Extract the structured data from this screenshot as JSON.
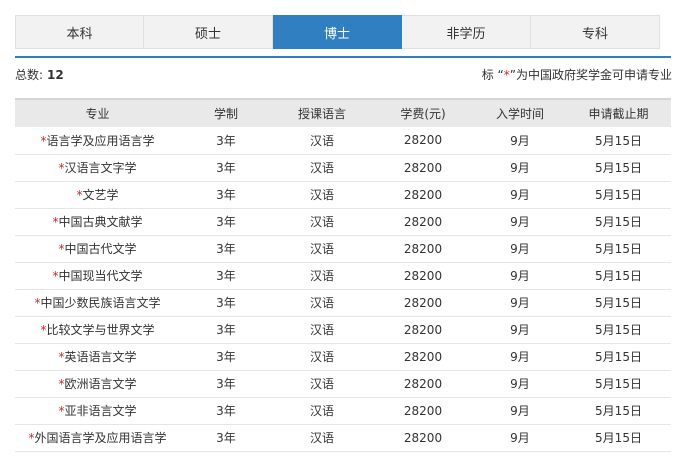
{
  "tabs": [
    {
      "label": "本科",
      "active": false
    },
    {
      "label": "硕士",
      "active": false
    },
    {
      "label": "博士",
      "active": true
    },
    {
      "label": "非学历",
      "active": false
    },
    {
      "label": "专科",
      "active": false
    }
  ],
  "summary": {
    "label": "总数:",
    "count": "12"
  },
  "note": {
    "prefix": "标 “",
    "star": "*",
    "suffix": "”为中国政府奖学金可申请专业"
  },
  "table": {
    "headers": [
      "专业",
      "学制",
      "授课语言",
      "学费(元)",
      "入学时间",
      "申请截止期"
    ],
    "rows": [
      {
        "star": "*",
        "major": "语言学及应用语言学",
        "duration": "3年",
        "language": "汉语",
        "tuition": "28200",
        "intake": "9月",
        "deadline": "5月15日"
      },
      {
        "star": "*",
        "major": "汉语言文字学",
        "duration": "3年",
        "language": "汉语",
        "tuition": "28200",
        "intake": "9月",
        "deadline": "5月15日"
      },
      {
        "star": "*",
        "major": "文艺学",
        "duration": "3年",
        "language": "汉语",
        "tuition": "28200",
        "intake": "9月",
        "deadline": "5月15日"
      },
      {
        "star": "*",
        "major": "中国古典文献学",
        "duration": "3年",
        "language": "汉语",
        "tuition": "28200",
        "intake": "9月",
        "deadline": "5月15日"
      },
      {
        "star": "*",
        "major": "中国古代文学",
        "duration": "3年",
        "language": "汉语",
        "tuition": "28200",
        "intake": "9月",
        "deadline": "5月15日"
      },
      {
        "star": "*",
        "major": "中国现当代文学",
        "duration": "3年",
        "language": "汉语",
        "tuition": "28200",
        "intake": "9月",
        "deadline": "5月15日"
      },
      {
        "star": "*",
        "major": "中国少数民族语言文学",
        "duration": "3年",
        "language": "汉语",
        "tuition": "28200",
        "intake": "9月",
        "deadline": "5月15日"
      },
      {
        "star": "*",
        "major": "比较文学与世界文学",
        "duration": "3年",
        "language": "汉语",
        "tuition": "28200",
        "intake": "9月",
        "deadline": "5月15日"
      },
      {
        "star": "*",
        "major": "英语语言文学",
        "duration": "3年",
        "language": "汉语",
        "tuition": "28200",
        "intake": "9月",
        "deadline": "5月15日"
      },
      {
        "star": "*",
        "major": "欧洲语言文学",
        "duration": "3年",
        "language": "汉语",
        "tuition": "28200",
        "intake": "9月",
        "deadline": "5月15日"
      },
      {
        "star": "*",
        "major": "亚非语言文学",
        "duration": "3年",
        "language": "汉语",
        "tuition": "28200",
        "intake": "9月",
        "deadline": "5月15日"
      },
      {
        "star": "*",
        "major": "外国语言学及应用语言学",
        "duration": "3年",
        "language": "汉语",
        "tuition": "28200",
        "intake": "9月",
        "deadline": "5月15日"
      }
    ]
  },
  "colors": {
    "accent": "#2f7fc1",
    "star": "#e02020",
    "header_bg": "#e9e9e9"
  }
}
